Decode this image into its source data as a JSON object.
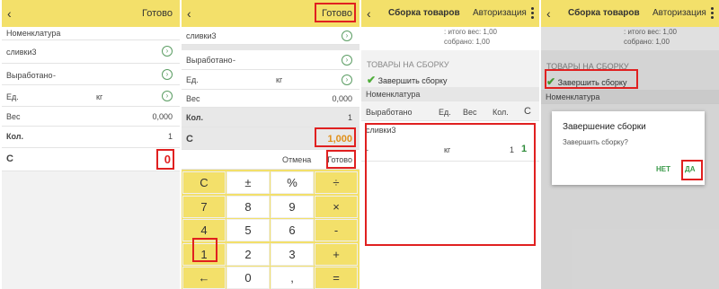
{
  "screen1": {
    "done": "Готово",
    "rows": {
      "nomen": "Номенклатура",
      "item": "сливки3",
      "produced": "Выработано",
      "produced_val": "-",
      "unit": "Ед.",
      "unit_val": "кг",
      "weight": "Вес",
      "weight_val": "0,000",
      "qty": "Кол.",
      "qty_val": "1",
      "c": "С",
      "c_val": "0"
    }
  },
  "screen2": {
    "done": "Готово",
    "rows": {
      "item": "сливки3",
      "produced": "Выработано",
      "produced_val": "-",
      "unit": "Ед.",
      "unit_val": "кг",
      "weight": "Вес",
      "weight_val": "0,000",
      "qty": "Кол.",
      "qty_val": "1",
      "c": "С",
      "c_val": "1,000"
    },
    "cancel": "Отмена",
    "done2": "Готово",
    "keys": [
      "C",
      "±",
      "%",
      "÷",
      "7",
      "8",
      "9",
      "×",
      "4",
      "5",
      "6",
      "-",
      "1",
      "2",
      "3",
      "+",
      "←",
      "0",
      ",",
      "="
    ]
  },
  "screen3": {
    "title": "Сборка товаров",
    "auth": "Авторизация",
    "total_weight": ": итого вес: 1,00",
    "collected": "собрано: 1,00",
    "section": "ТОВАРЫ НА СБОРКУ",
    "finish": "Завершить сборку",
    "nomen": "Номенклатура",
    "cols": [
      "Выработано",
      "Ед.",
      "Вес",
      "Кол.",
      "С"
    ],
    "item": "сливки3",
    "row_dash": "-",
    "row_unit": "кг",
    "row_qty": "1",
    "row_c": "1"
  },
  "screen4": {
    "title": "Сборка товаров",
    "auth": "Авторизация",
    "total_weight": ": итого вес: 1,00",
    "collected": "собрано: 1,00",
    "section": "ТОВАРЫ НА СБОРКУ",
    "finish": "Завершить сборку",
    "nomen": "Номенклатура",
    "dialog_title": "Завершение сборки",
    "dialog_text": "Завершить сборку?",
    "no": "НЕТ",
    "yes": "ДА"
  },
  "colors": {
    "accent": "#f3e06a",
    "highlight": "#e02020",
    "green": "#5b9d63",
    "orange": "#e0901a"
  }
}
